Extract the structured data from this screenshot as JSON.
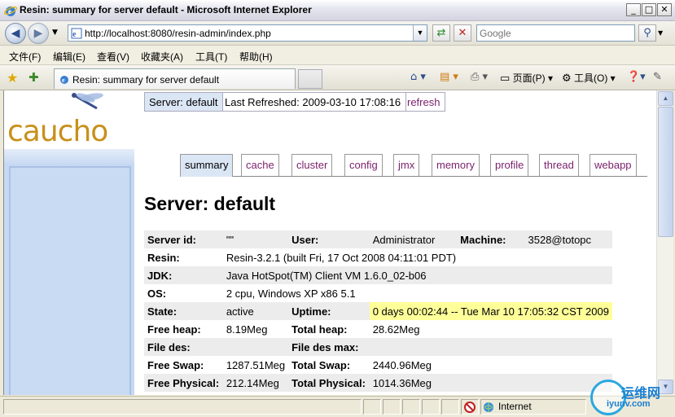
{
  "window": {
    "title": "Resin: summary for server default - Microsoft Internet Explorer",
    "buttons": {
      "minimize": "_",
      "maximize": "□",
      "close": "✕"
    }
  },
  "address_bar": {
    "url": "http://localhost:8080/resin-admin/index.php",
    "search_placeholder": "Google"
  },
  "menu": [
    "文件(F)",
    "编辑(E)",
    "查看(V)",
    "收藏夹(A)",
    "工具(T)",
    "帮助(H)"
  ],
  "tabbar": {
    "active_tab": "Resin: summary for server default",
    "commands": {
      "page": "页面(P)",
      "tools": "工具(O)"
    }
  },
  "page": {
    "logo": "caucho",
    "header": {
      "server": "Server: default",
      "last_refreshed": "Last Refreshed: 2009-03-10 17:08:16",
      "refresh": "refresh"
    },
    "nav_tabs": [
      "summary",
      "cache",
      "cluster",
      "config",
      "jmx",
      "memory",
      "profile",
      "thread",
      "webapp"
    ],
    "active_nav": "summary",
    "title": "Server: default",
    "info": {
      "server_id_label": "Server id:",
      "server_id": "\"\"",
      "user_label": "User:",
      "user": "Administrator",
      "machine_label": "Machine:",
      "machine": "3528@totopc",
      "resin_label": "Resin:",
      "resin": "Resin-3.2.1 (built Fri, 17 Oct 2008 04:11:01 PDT)",
      "jdk_label": "JDK:",
      "jdk": "Java HotSpot(TM) Client VM 1.6.0_02-b06",
      "os_label": "OS:",
      "os": "2 cpu, Windows XP x86 5.1",
      "state_label": "State:",
      "state": "active",
      "uptime_label": "Uptime:",
      "uptime": "0 days 00:02:44 -- Tue Mar 10 17:05:32 CST 2009",
      "free_heap_label": "Free heap:",
      "free_heap": "8.19Meg",
      "total_heap_label": "Total heap:",
      "total_heap": "28.62Meg",
      "file_des_label": "File des:",
      "file_des": "",
      "file_des_max_label": "File des max:",
      "file_des_max": "",
      "free_swap_label": "Free Swap:",
      "free_swap": "1287.51Meg",
      "total_swap_label": "Total Swap:",
      "total_swap": "2440.96Meg",
      "free_physical_label": "Free Physical:",
      "free_physical": "212.14Meg",
      "total_physical_label": "Total Physical:",
      "total_physical": "1014.36Meg"
    }
  },
  "status_bar": {
    "zone": "Internet"
  },
  "watermark": {
    "text": "运维网",
    "url": "iyunv.com"
  },
  "colors": {
    "link": "#7a1f6c",
    "highlight": "#ffff99",
    "sidebar": "#c6d8f2",
    "logo": "#c8901a"
  }
}
